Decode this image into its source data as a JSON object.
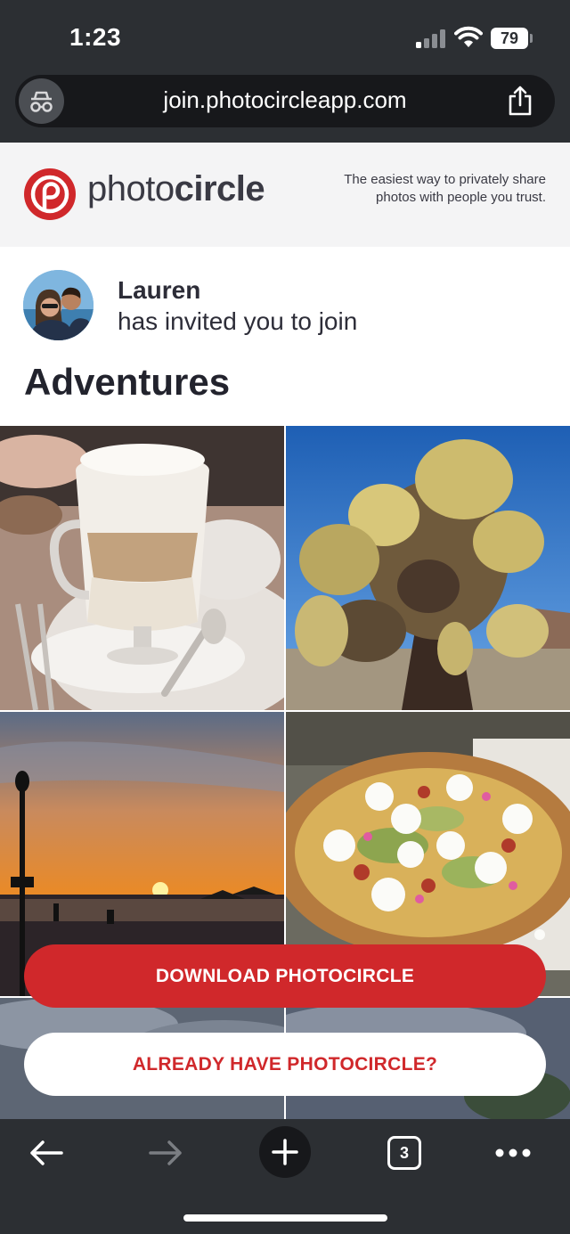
{
  "status_bar": {
    "time": "1:23",
    "battery": "79"
  },
  "browser": {
    "url": "join.photocircleapp.com",
    "tab_count": "3"
  },
  "brand": {
    "logo_light": "photo",
    "logo_bold": "circle",
    "tagline": "The easiest way to privately share photos with people you trust."
  },
  "invite": {
    "inviter_name": "Lauren",
    "invite_text": "has invited you to join",
    "circle_name": "Adventures"
  },
  "photos": [
    {
      "subject": "latte"
    },
    {
      "subject": "cholla-cactus"
    },
    {
      "subject": "sunset-beach"
    },
    {
      "subject": "pizza"
    },
    {
      "subject": "clouds"
    },
    {
      "subject": "clouds"
    }
  ],
  "actions": {
    "download_label": "DOWNLOAD PHOTOCIRCLE",
    "already_have_label": "ALREADY HAVE PHOTOCIRCLE?"
  },
  "colors": {
    "brand_red": "#d0282b",
    "chrome_dark": "#2c2f33"
  },
  "icons": [
    "incognito-icon",
    "share-icon",
    "back-arrow-icon",
    "forward-arrow-icon",
    "plus-icon",
    "tabs-icon",
    "more-icon"
  ]
}
